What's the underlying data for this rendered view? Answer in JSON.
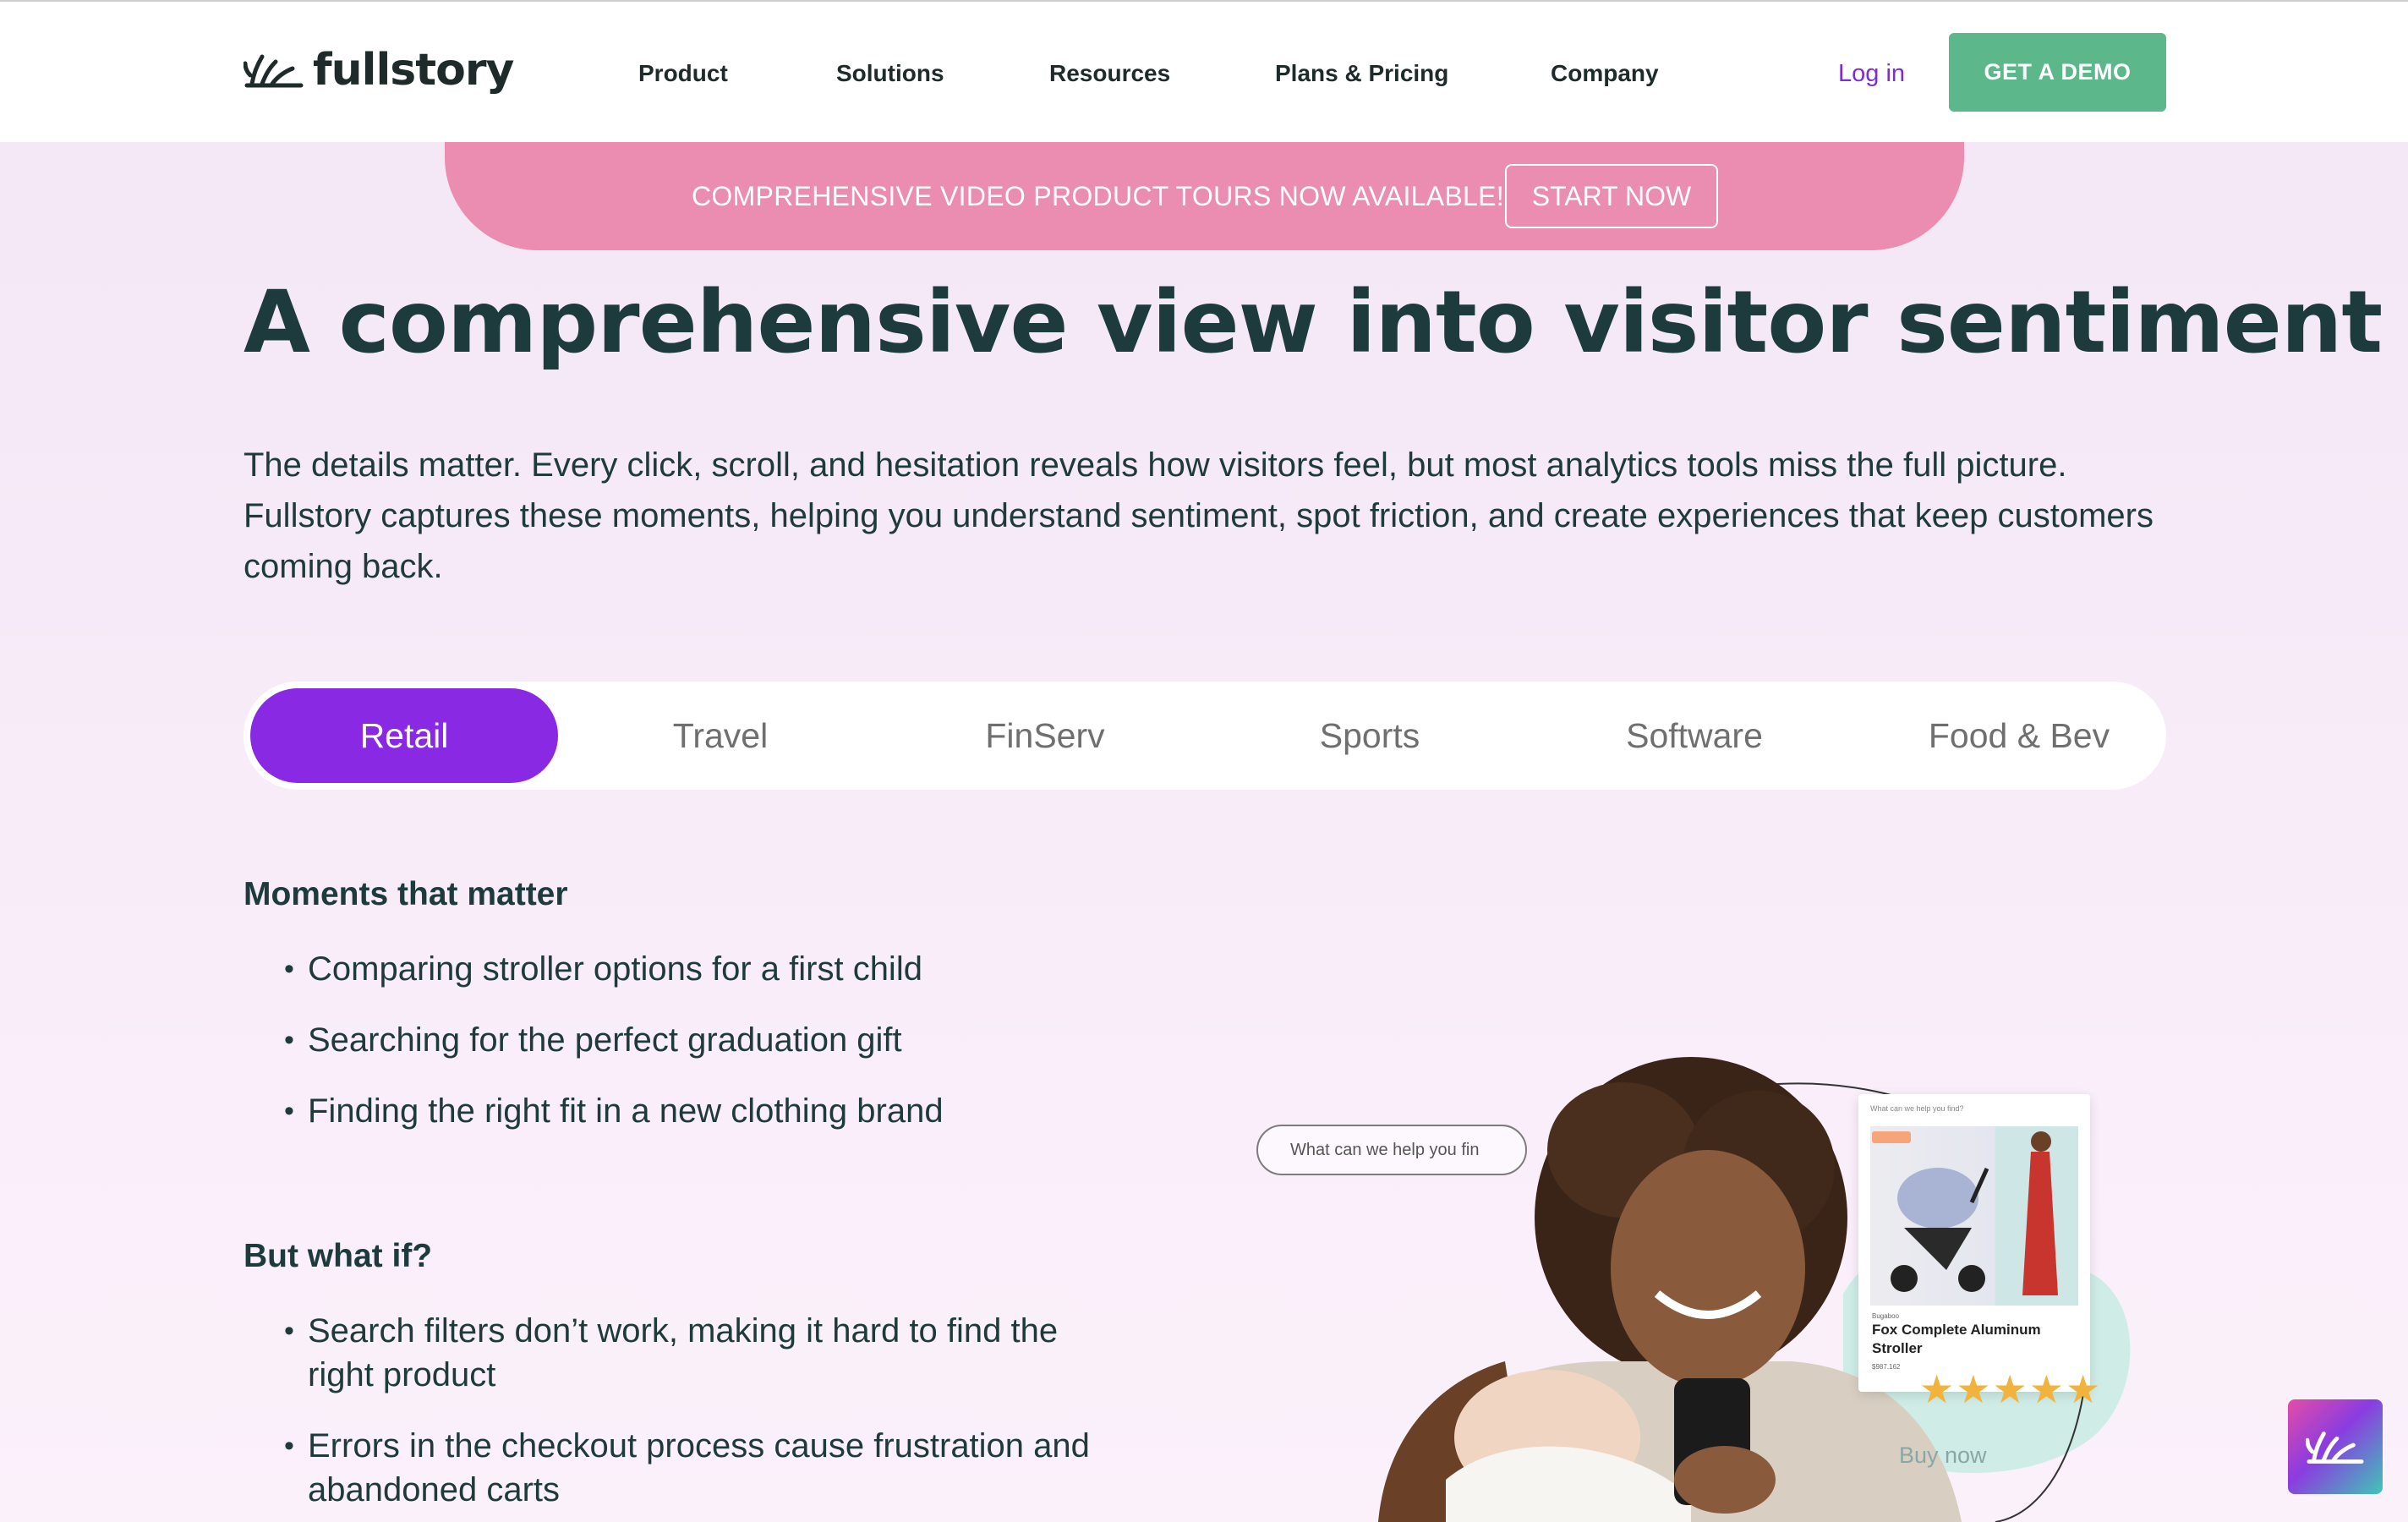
{
  "header": {
    "logo_text": "fullstory",
    "nav": [
      "Product",
      "Solutions",
      "Resources",
      "Plans & Pricing",
      "Company"
    ],
    "login_label": "Log in",
    "demo_label": "GET A DEMO"
  },
  "banner": {
    "text": "COMPREHENSIVE VIDEO PRODUCT TOURS NOW AVAILABLE!",
    "button_label": "START NOW"
  },
  "hero": {
    "title": "A comprehensive view into visitor sentiment",
    "body": "The details matter. Every click, scroll, and hesitation reveals how visitors feel, but most analytics tools miss the full picture. Fullstory captures these moments, helping you understand sentiment, spot friction, and create experiences that keep customers coming back."
  },
  "tabs": [
    {
      "label": "Retail",
      "active": true
    },
    {
      "label": "Travel",
      "active": false
    },
    {
      "label": "FinServ",
      "active": false
    },
    {
      "label": "Sports",
      "active": false
    },
    {
      "label": "Software",
      "active": false
    },
    {
      "label": "Food & Bev",
      "active": false
    }
  ],
  "moments": {
    "heading": "Moments that matter",
    "items": [
      "Comparing stroller options for a first child",
      "Searching for the perfect graduation gift",
      "Finding the right fit in a new clothing brand"
    ]
  },
  "whatif": {
    "heading": "But what if?",
    "items": [
      "Search filters don’t work, making it hard to find the right product",
      "Errors in the checkout process cause frustration and abandoned carts"
    ]
  },
  "illustration": {
    "search_text": "What can we help you fin",
    "card_search": "What can we help you find?",
    "card_brand": "Bugaboo",
    "product_name": "Fox Complete Aluminum Stroller",
    "card_price": "$987.162",
    "rating_stars": 5,
    "buy_label": "Buy now"
  },
  "colors": {
    "brand_green": "#5cb88a",
    "brand_purple": "#8a29e3",
    "banner_pink": "#eb8cb1",
    "heading_teal": "#1d3b3d"
  },
  "icons": [
    "fullstory-logo-icon",
    "search-icon",
    "fullstory-chat-icon"
  ]
}
